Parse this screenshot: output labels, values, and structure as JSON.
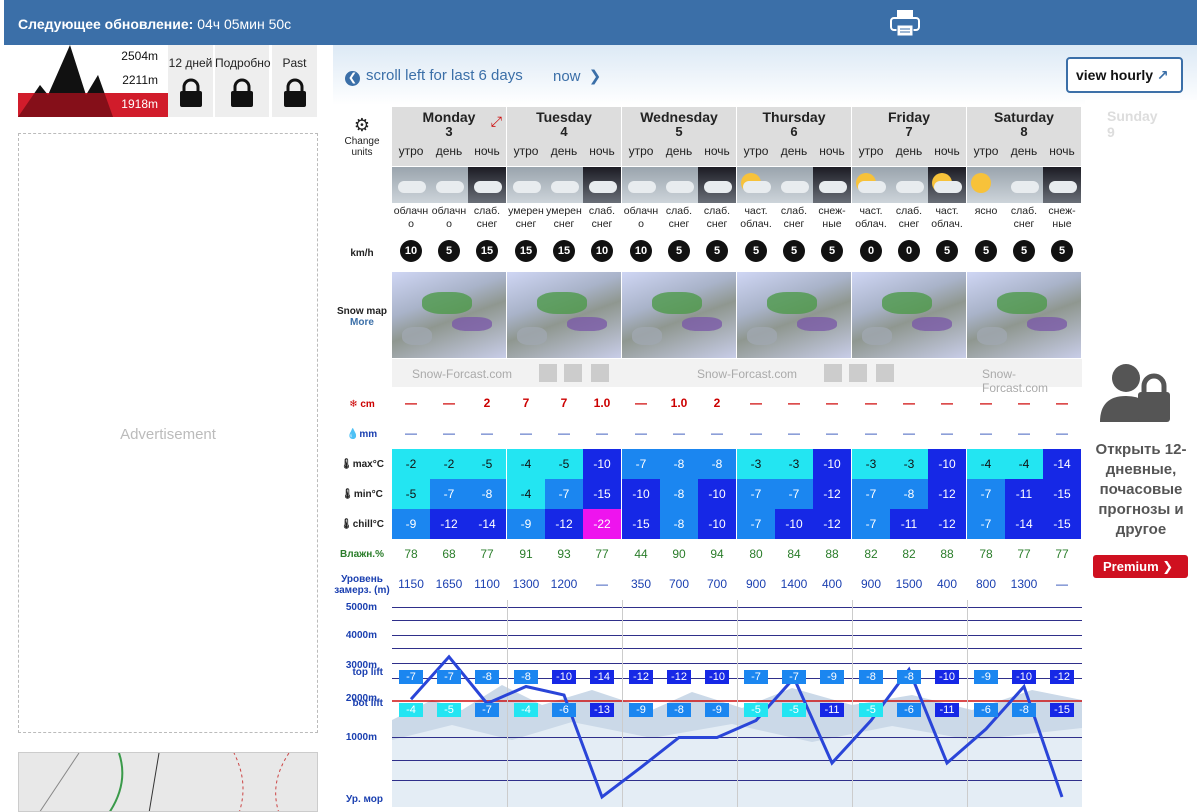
{
  "header": {
    "update_label": "Следующее обновление:",
    "update_value": "04ч 05мин 50с"
  },
  "elevations": [
    "2504",
    "2211",
    "1918"
  ],
  "elev_unit": "m",
  "lock_tabs": [
    {
      "label": "12 дней"
    },
    {
      "label": "Подробно"
    },
    {
      "label": "Past"
    }
  ],
  "advertisement": "Advertisement",
  "nav": {
    "scroll_left": "scroll left for last 6 days",
    "now": "now",
    "view_hourly": "view hourly"
  },
  "row_labels": {
    "change_units": "Change units",
    "wind": "km/h",
    "snow_map": "Snow map",
    "more": "More",
    "snow_cm": "cm",
    "rain_mm": "mm",
    "max": "max°C",
    "min": "min°C",
    "chill": "chill°C",
    "humidity": "Влажн.%",
    "freezing": "Уровень замерз. (m)",
    "alt_5000": "5000m",
    "alt_4000": "4000m",
    "alt_3000": "3000m",
    "top_lift": "top lift",
    "alt_2000": "2000m",
    "bot_lift": "bot lift",
    "alt_1000": "1000m",
    "sea": "Ур. мор"
  },
  "brand": "Snow-Forcast.com",
  "days": [
    {
      "name": "Monday",
      "num": "3",
      "tod": [
        "утро",
        "день",
        "ночь"
      ],
      "desc": [
        "облачн о",
        "облачн о",
        "слаб. снег"
      ],
      "wind": [
        "10",
        "5",
        "15"
      ],
      "snow": [
        "—",
        "—",
        "2"
      ],
      "rain": [
        "—",
        "—",
        "—"
      ],
      "max": [
        "-2",
        "-2",
        "-5"
      ],
      "min": [
        "-5",
        "-7",
        "-8"
      ],
      "chill": [
        "-9",
        "-12",
        "-14"
      ],
      "hum": [
        "78",
        "68",
        "77"
      ],
      "frz": [
        "1150",
        "1650",
        "1100"
      ],
      "top": [
        "-7",
        "-7",
        "-8"
      ],
      "bot": [
        "-4",
        "-5",
        "-7"
      ]
    },
    {
      "name": "Tuesday",
      "num": "4",
      "tod": [
        "утро",
        "день",
        "ночь"
      ],
      "desc": [
        "умерен снег",
        "умерен снег",
        "слаб. снег"
      ],
      "wind": [
        "15",
        "15",
        "10"
      ],
      "snow": [
        "7",
        "7",
        "1.0"
      ],
      "rain": [
        "—",
        "—",
        "—"
      ],
      "max": [
        "-4",
        "-5",
        "-10"
      ],
      "min": [
        "-4",
        "-7",
        "-15"
      ],
      "chill": [
        "-9",
        "-12",
        "-22"
      ],
      "hum": [
        "91",
        "93",
        "77"
      ],
      "frz": [
        "1300",
        "1200",
        "—"
      ],
      "top": [
        "-8",
        "-10",
        "-14"
      ],
      "bot": [
        "-4",
        "-6",
        "-13"
      ]
    },
    {
      "name": "Wednesday",
      "num": "5",
      "tod": [
        "утро",
        "день",
        "ночь"
      ],
      "desc": [
        "облачн о",
        "слаб. снег",
        "слаб. снег"
      ],
      "wind": [
        "10",
        "5",
        "5"
      ],
      "snow": [
        "—",
        "1.0",
        "2"
      ],
      "rain": [
        "—",
        "—",
        "—"
      ],
      "max": [
        "-7",
        "-8",
        "-8"
      ],
      "min": [
        "-10",
        "-8",
        "-10"
      ],
      "chill": [
        "-15",
        "-8",
        "-10"
      ],
      "hum": [
        "44",
        "90",
        "94"
      ],
      "frz": [
        "350",
        "700",
        "700"
      ],
      "top": [
        "-12",
        "-12",
        "-10"
      ],
      "bot": [
        "-9",
        "-8",
        "-9"
      ]
    },
    {
      "name": "Thursday",
      "num": "6",
      "tod": [
        "утро",
        "день",
        "ночь"
      ],
      "desc": [
        "част. облач.",
        "слаб. снег",
        "снеж- ные"
      ],
      "wind": [
        "5",
        "5",
        "5"
      ],
      "snow": [
        "—",
        "—",
        "—"
      ],
      "rain": [
        "—",
        "—",
        "—"
      ],
      "max": [
        "-3",
        "-3",
        "-10"
      ],
      "min": [
        "-7",
        "-7",
        "-12"
      ],
      "chill": [
        "-7",
        "-10",
        "-12"
      ],
      "hum": [
        "80",
        "84",
        "88"
      ],
      "frz": [
        "900",
        "1400",
        "400"
      ],
      "top": [
        "-7",
        "-7",
        "-9"
      ],
      "bot": [
        "-5",
        "-5",
        "-11"
      ]
    },
    {
      "name": "Friday",
      "num": "7",
      "tod": [
        "утро",
        "день",
        "ночь"
      ],
      "desc": [
        "част. облач.",
        "слаб. снег",
        "част. облач."
      ],
      "wind": [
        "0",
        "0",
        "5"
      ],
      "snow": [
        "—",
        "—",
        "—"
      ],
      "rain": [
        "—",
        "—",
        "—"
      ],
      "max": [
        "-3",
        "-3",
        "-10"
      ],
      "min": [
        "-7",
        "-8",
        "-12"
      ],
      "chill": [
        "-7",
        "-11",
        "-12"
      ],
      "hum": [
        "82",
        "82",
        "88"
      ],
      "frz": [
        "900",
        "1500",
        "400"
      ],
      "top": [
        "-8",
        "-8",
        "-10"
      ],
      "bot": [
        "-5",
        "-6",
        "-11"
      ]
    },
    {
      "name": "Saturday",
      "num": "8",
      "tod": [
        "утро",
        "день",
        "ночь"
      ],
      "desc": [
        "ясно",
        "слаб. снег",
        "снеж- ные"
      ],
      "wind": [
        "5",
        "5",
        "5"
      ],
      "snow": [
        "—",
        "—",
        "—"
      ],
      "rain": [
        "—",
        "—",
        "—"
      ],
      "max": [
        "-4",
        "-4",
        "-14"
      ],
      "min": [
        "-7",
        "-11",
        "-15"
      ],
      "chill": [
        "-7",
        "-14",
        "-15"
      ],
      "hum": [
        "78",
        "77",
        "77"
      ],
      "frz": [
        "800",
        "1300",
        "—"
      ],
      "top": [
        "-9",
        "-10",
        "-12"
      ],
      "bot": [
        "-6",
        "-8",
        "-15"
      ]
    }
  ],
  "ghost_day": {
    "name": "Sunday",
    "num": "9"
  },
  "premium": {
    "info": "Открыть 12-дневные, почасовые прогнозы и другое",
    "button": "Premium"
  },
  "colors": {
    "header": "#3b6fa8",
    "premium": "#cf1020"
  }
}
